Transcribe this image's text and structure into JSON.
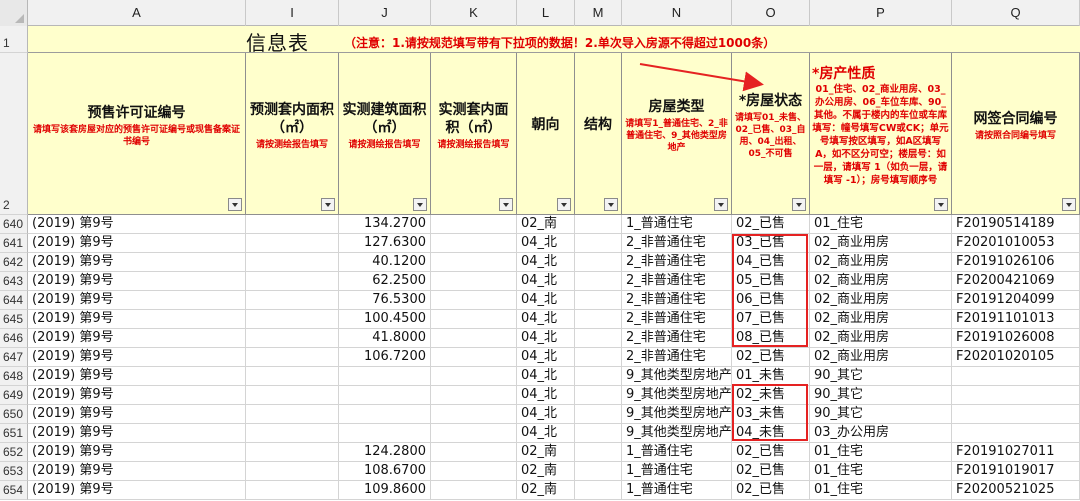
{
  "columns": [
    {
      "id": "A",
      "label": "A"
    },
    {
      "id": "I",
      "label": "I"
    },
    {
      "id": "J",
      "label": "J"
    },
    {
      "id": "K",
      "label": "K"
    },
    {
      "id": "L",
      "label": "L"
    },
    {
      "id": "M",
      "label": "M"
    },
    {
      "id": "N",
      "label": "N"
    },
    {
      "id": "O",
      "label": "O"
    },
    {
      "id": "P",
      "label": "P"
    },
    {
      "id": "Q",
      "label": "Q"
    }
  ],
  "title": {
    "main": "信息表",
    "note": "（注意：1.请按规范填写带有下拉项的数据！2.单次导入房源不得超过1000条）"
  },
  "row_numbers": {
    "title": "1",
    "header": "2",
    "data": [
      "640",
      "641",
      "642",
      "643",
      "644",
      "645",
      "646",
      "647",
      "648",
      "649",
      "650",
      "651",
      "652",
      "653",
      "654"
    ]
  },
  "headers": {
    "A": {
      "title": "预售许可证编号",
      "note": "请填写该套房屋对应的预售许可证编号或现售备案证书编号"
    },
    "I": {
      "title": "预测套内面积（㎡）",
      "note": "请按测绘报告填写"
    },
    "J": {
      "title": "实测建筑面积（㎡）",
      "note": "请按测绘报告填写"
    },
    "K": {
      "title": "实测套内面积（㎡）",
      "note": "请按测绘报告填写"
    },
    "L": {
      "title": "朝向",
      "note": ""
    },
    "M": {
      "title": "结构",
      "note": ""
    },
    "N": {
      "title": "房屋类型",
      "note": "请填写1_普通住宅、2_非普通住宅、9_其他类型房地产"
    },
    "O": {
      "title": "*房屋状态",
      "note": "请填写01_未售、02_已售、03_自用、04_出租、05_不可售"
    },
    "P": {
      "title": "*房产性质",
      "note": "01_住宅、02_商业用房、03_办公用房、06_车位车库、90_其他。不属于楼内的车位或车库填写：幢号填写CW或CK；单元号填写按区填写，如A区填写A，如不区分可空；楼层号：如一层，请填写 1（如负一层，请填写 -1）；房号填写顺序号"
    },
    "Q": {
      "title": "网签合同编号",
      "note": "请按照合同编号填写"
    }
  },
  "rows": [
    {
      "A": "(2019) 第9号",
      "I": "",
      "J": "134.2700",
      "K": "",
      "L": "02_南",
      "M": "",
      "N": "1_普通住宅",
      "O": "02_已售",
      "P": "01_住宅",
      "Q": "F20190514189"
    },
    {
      "A": "(2019) 第9号",
      "I": "",
      "J": "127.6300",
      "K": "",
      "L": "04_北",
      "M": "",
      "N": "2_非普通住宅",
      "O": "03_已售",
      "P": "02_商业用房",
      "Q": "F20201010053"
    },
    {
      "A": "(2019) 第9号",
      "I": "",
      "J": "40.1200",
      "K": "",
      "L": "04_北",
      "M": "",
      "N": "2_非普通住宅",
      "O": "04_已售",
      "P": "02_商业用房",
      "Q": "F20191026106"
    },
    {
      "A": "(2019) 第9号",
      "I": "",
      "J": "62.2500",
      "K": "",
      "L": "04_北",
      "M": "",
      "N": "2_非普通住宅",
      "O": "05_已售",
      "P": "02_商业用房",
      "Q": "F20200421069"
    },
    {
      "A": "(2019) 第9号",
      "I": "",
      "J": "76.5300",
      "K": "",
      "L": "04_北",
      "M": "",
      "N": "2_非普通住宅",
      "O": "06_已售",
      "P": "02_商业用房",
      "Q": "F20191204099"
    },
    {
      "A": "(2019) 第9号",
      "I": "",
      "J": "100.4500",
      "K": "",
      "L": "04_北",
      "M": "",
      "N": "2_非普通住宅",
      "O": "07_已售",
      "P": "02_商业用房",
      "Q": "F20191101013"
    },
    {
      "A": "(2019) 第9号",
      "I": "",
      "J": "41.8000",
      "K": "",
      "L": "04_北",
      "M": "",
      "N": "2_非普通住宅",
      "O": "08_已售",
      "P": "02_商业用房",
      "Q": "F20191026008"
    },
    {
      "A": "(2019) 第9号",
      "I": "",
      "J": "106.7200",
      "K": "",
      "L": "04_北",
      "M": "",
      "N": "2_非普通住宅",
      "O": "02_已售",
      "P": "02_商业用房",
      "Q": "F20201020105"
    },
    {
      "A": "(2019) 第9号",
      "I": "",
      "J": "",
      "K": "",
      "L": "04_北",
      "M": "",
      "N": "9_其他类型房地产",
      "O": "01_未售",
      "P": "90_其它",
      "Q": ""
    },
    {
      "A": "(2019) 第9号",
      "I": "",
      "J": "",
      "K": "",
      "L": "04_北",
      "M": "",
      "N": "9_其他类型房地产",
      "O": "02_未售",
      "P": "90_其它",
      "Q": ""
    },
    {
      "A": "(2019) 第9号",
      "I": "",
      "J": "",
      "K": "",
      "L": "04_北",
      "M": "",
      "N": "9_其他类型房地产",
      "O": "03_未售",
      "P": "90_其它",
      "Q": ""
    },
    {
      "A": "(2019) 第9号",
      "I": "",
      "J": "",
      "K": "",
      "L": "04_北",
      "M": "",
      "N": "9_其他类型房地产",
      "O": "04_未售",
      "P": "03_办公用房",
      "Q": ""
    },
    {
      "A": "(2019) 第9号",
      "I": "",
      "J": "124.2800",
      "K": "",
      "L": "02_南",
      "M": "",
      "N": "1_普通住宅",
      "O": "02_已售",
      "P": "01_住宅",
      "Q": "F20191027011"
    },
    {
      "A": "(2019) 第9号",
      "I": "",
      "J": "108.6700",
      "K": "",
      "L": "02_南",
      "M": "",
      "N": "1_普通住宅",
      "O": "02_已售",
      "P": "01_住宅",
      "Q": "F20191019017"
    },
    {
      "A": "(2019) 第9号",
      "I": "",
      "J": "109.8600",
      "K": "",
      "L": "02_南",
      "M": "",
      "N": "1_普通住宅",
      "O": "02_已售",
      "P": "01_住宅",
      "Q": "F20200521025"
    }
  ],
  "colors": {
    "header_bg": "#ffffcc",
    "note_red": "#e00000",
    "highlight": "#e52222"
  }
}
